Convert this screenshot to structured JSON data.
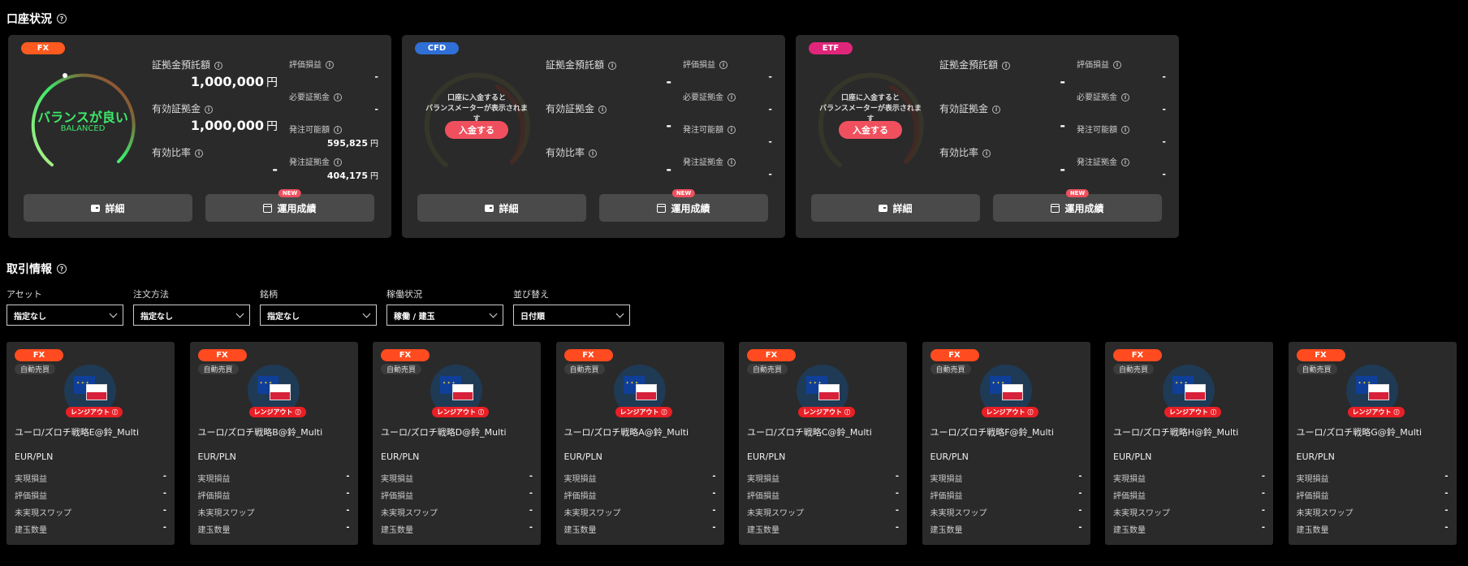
{
  "account_section": {
    "title": "口座状況",
    "help": "?"
  },
  "accounts": [
    {
      "badge": "FX",
      "badge_color": "#ff5a1f",
      "funded": true,
      "gauge_main": "バランスが良い",
      "gauge_sub": "BALANCED",
      "margin_deposit_label": "証拠金預託額",
      "margin_deposit_value": "1,000,000",
      "margin_deposit_unit": "円",
      "effective_margin_label": "有効証拠金",
      "effective_margin_value": "1,000,000",
      "effective_margin_unit": "円",
      "effective_ratio_label": "有効比率",
      "effective_ratio_value": "-",
      "unrealized_label": "評価損益",
      "unrealized_value": "-",
      "required_label": "必要証拠金",
      "required_value": "-",
      "orderable_label": "発注可能額",
      "orderable_value": "595,825",
      "orderable_unit": "円",
      "order_margin_label": "発注証拠金",
      "order_margin_value": "404,175",
      "order_margin_unit": "円",
      "detail_btn": "詳細",
      "perf_btn": "運用成績",
      "new_badge": "NEW"
    },
    {
      "badge": "CFD",
      "badge_color": "#2f6fd6",
      "funded": false,
      "gauge_msg": "口座に入金すると\nバランスメーターが表示されます",
      "deposit_btn": "入金する",
      "margin_deposit_label": "証拠金預託額",
      "margin_deposit_value": "-",
      "effective_margin_label": "有効証拠金",
      "effective_margin_value": "-",
      "effective_ratio_label": "有効比率",
      "effective_ratio_value": "-",
      "unrealized_label": "評価損益",
      "unrealized_value": "-",
      "required_label": "必要証拠金",
      "required_value": "-",
      "orderable_label": "発注可能額",
      "orderable_value": "-",
      "order_margin_label": "発注証拠金",
      "order_margin_value": "-",
      "detail_btn": "詳細",
      "perf_btn": "運用成績",
      "new_badge": "NEW"
    },
    {
      "badge": "ETF",
      "badge_color": "#e0267a",
      "funded": false,
      "gauge_msg": "口座に入金すると\nバランスメーターが表示されます",
      "deposit_btn": "入金する",
      "margin_deposit_label": "証拠金預託額",
      "margin_deposit_value": "-",
      "effective_margin_label": "有効証拠金",
      "effective_margin_value": "-",
      "effective_ratio_label": "有効比率",
      "effective_ratio_value": "-",
      "unrealized_label": "評価損益",
      "unrealized_value": "-",
      "required_label": "必要証拠金",
      "required_value": "-",
      "orderable_label": "発注可能額",
      "orderable_value": "-",
      "order_margin_label": "発注証拠金",
      "order_margin_value": "-",
      "detail_btn": "詳細",
      "perf_btn": "運用成績",
      "new_badge": "NEW"
    }
  ],
  "trade_section": {
    "title": "取引情報",
    "help": "?"
  },
  "filters": [
    {
      "label": "アセット",
      "value": "指定なし"
    },
    {
      "label": "注文方法",
      "value": "指定なし"
    },
    {
      "label": "銘柄",
      "value": "指定なし"
    },
    {
      "label": "稼働状況",
      "value": "稼働 / 建玉"
    },
    {
      "label": "並び替え",
      "value": "日付順"
    }
  ],
  "strategy_common": {
    "badge": "FX",
    "tag": "自動売買",
    "range": "レンジアウト",
    "pair": "EUR/PLN",
    "row_labels": [
      "実現損益",
      "評価損益",
      "未実現スワップ",
      "建玉数量"
    ],
    "row_values": [
      "-",
      "-",
      "-",
      "-"
    ]
  },
  "strategies": [
    {
      "name": "ユーロ/ズロチ戦略E@鈴_Multi"
    },
    {
      "name": "ユーロ/ズロチ戦略B@鈴_Multi"
    },
    {
      "name": "ユーロ/ズロチ戦略D@鈴_Multi"
    },
    {
      "name": "ユーロ/ズロチ戦略A@鈴_Multi"
    },
    {
      "name": "ユーロ/ズロチ戦略C@鈴_Multi"
    },
    {
      "name": "ユーロ/ズロチ戦略F@鈴_Multi"
    },
    {
      "name": "ユーロ/ズロチ戦略H@鈴_Multi"
    },
    {
      "name": "ユーロ/ズロチ戦略G@鈴_Multi"
    }
  ]
}
